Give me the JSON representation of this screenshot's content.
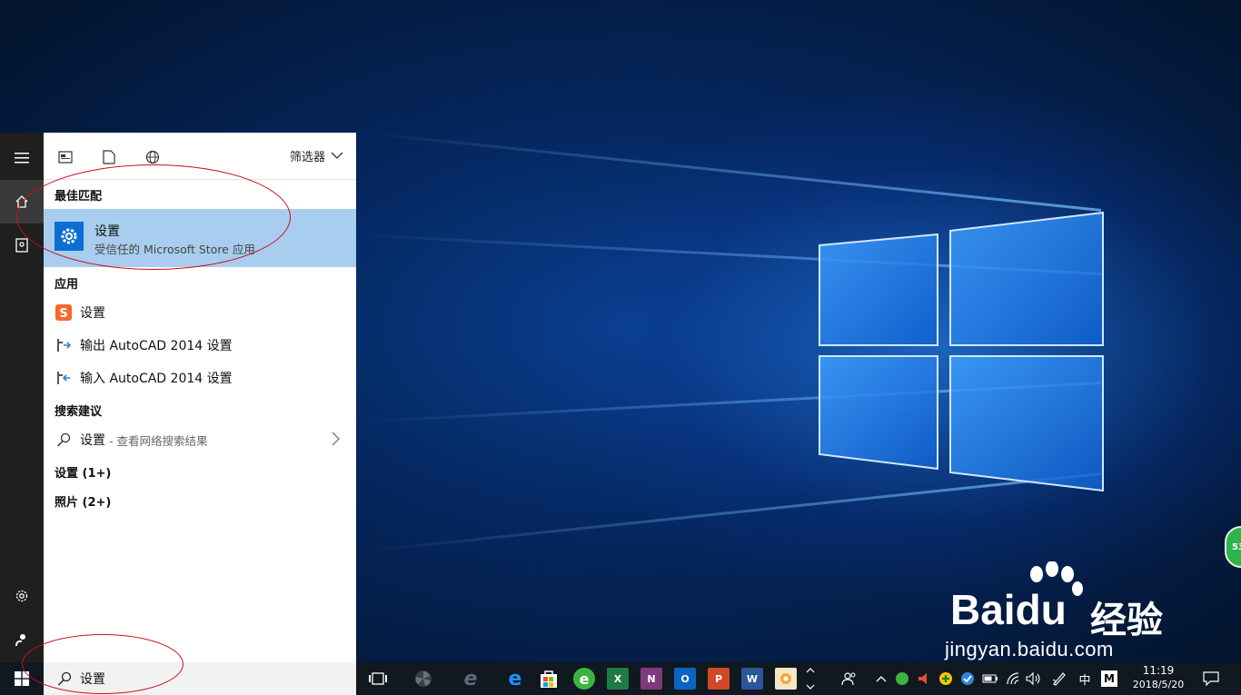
{
  "start_menu": {
    "rail": {
      "menu_icon": "hamburger-icon",
      "home_icon": "home-icon",
      "documents_icon": "notebook-icon",
      "settings_icon": "gear-icon",
      "user_icon": "user-icon"
    },
    "header": {
      "filter_label": "筛选器"
    },
    "best_match": {
      "title": "最佳匹配",
      "item": {
        "name": "设置",
        "subtitle": "受信任的 Microsoft Store 应用"
      }
    },
    "apps": {
      "title": "应用",
      "items": [
        {
          "label": "设置"
        },
        {
          "label": "输出 AutoCAD 2014 设置"
        },
        {
          "label": "输入 AutoCAD 2014 设置"
        }
      ]
    },
    "suggestions": {
      "title": "搜索建议",
      "item": {
        "label": "设置",
        "hint": "- 查看网络搜索结果"
      }
    },
    "more": [
      {
        "label": "设置 (1+)"
      },
      {
        "label": "照片 (2+)"
      }
    ]
  },
  "taskbar": {
    "search": {
      "value": "设置"
    },
    "apps": [
      {
        "name": "task-view",
        "label": ""
      },
      {
        "name": "app-fan",
        "label": ""
      },
      {
        "name": "ie",
        "label": "e"
      },
      {
        "name": "edge",
        "label": "e"
      },
      {
        "name": "store",
        "label": ""
      },
      {
        "name": "browser-green",
        "label": "e"
      },
      {
        "name": "excel",
        "label": "X"
      },
      {
        "name": "onenote",
        "label": "N"
      },
      {
        "name": "outlook",
        "label": "O"
      },
      {
        "name": "powerpoint",
        "label": "P"
      },
      {
        "name": "word",
        "label": "W"
      },
      {
        "name": "photos",
        "label": ""
      }
    ],
    "tray": {
      "ime_label": "中",
      "m_label": "M"
    },
    "clock": {
      "time": "11:19",
      "date": "2018/5/20"
    }
  },
  "watermark": {
    "url": "jingyan.baidu.com",
    "brand": "Bai",
    "brand2": "du",
    "brand_cn": "经验",
    "badge": "53"
  },
  "colors": {
    "accent": "#0b6ed3",
    "selection": "#a9cdee",
    "taskbar": "#101820",
    "rail": "#1f1f1f"
  }
}
